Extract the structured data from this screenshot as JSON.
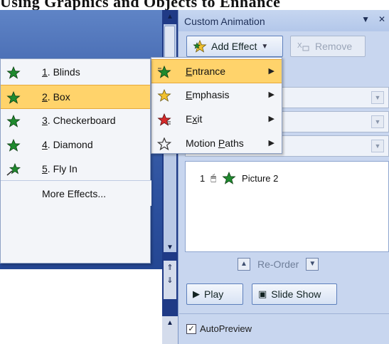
{
  "header_text": "Using Graphics and Objects to Enhance",
  "pane": {
    "title": "Custom Animation",
    "controls": {
      "dropdown": "▼",
      "close": "✕"
    },
    "add_effect": "Add Effect",
    "remove": "Remove",
    "list_item": {
      "order": "1",
      "name": "Picture 2"
    },
    "reorder": "Re-Order",
    "play": "Play",
    "slide_show": "Slide Show",
    "autopreview": "AutoPreview",
    "autopreview_checked": true
  },
  "effect_menu": {
    "items": [
      {
        "pre": "",
        "key": "E",
        "post": "ntrance",
        "icon": "entrance-star-icon",
        "highlighted": true
      },
      {
        "pre": "",
        "key": "E",
        "post": "mphasis",
        "icon": "emphasis-star-icon",
        "highlighted": false
      },
      {
        "pre": "E",
        "key": "x",
        "post": "it",
        "icon": "exit-star-icon",
        "highlighted": false
      },
      {
        "pre": "Motion ",
        "key": "P",
        "post": "aths",
        "icon": "motion-paths-star-icon",
        "highlighted": false
      }
    ]
  },
  "entrance_menu": {
    "items": [
      {
        "num": "1",
        "label": ". Blinds",
        "highlighted": false
      },
      {
        "num": "2",
        "label": ". Box",
        "highlighted": true
      },
      {
        "num": "3",
        "label": ". Checkerboard",
        "highlighted": false
      },
      {
        "num": "4",
        "label": ". Diamond",
        "highlighted": false
      },
      {
        "num": "5",
        "label": ". Fly In",
        "highlighted": false
      }
    ],
    "more": "More Effects..."
  },
  "colors": {
    "highlight": "#ffd36b",
    "star_green": "#1f8a2e",
    "star_yellow": "#f2c12e",
    "star_red": "#d62a2a"
  }
}
